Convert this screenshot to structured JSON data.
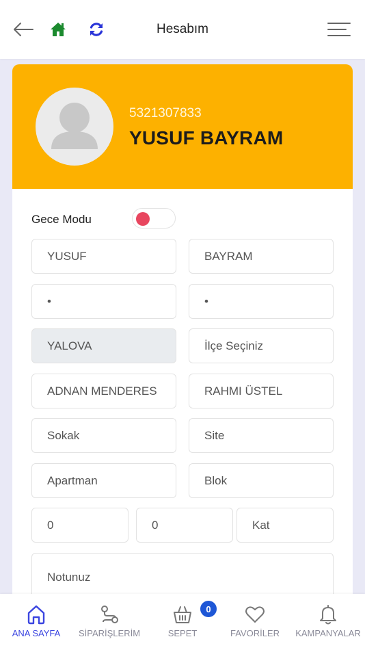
{
  "header": {
    "title": "Hesabım",
    "home_color": "#1b8a2e",
    "refresh_color": "#2a35d8"
  },
  "profile": {
    "phone": "5321307833",
    "name": "YUSUF BAYRAM",
    "banner_color": "#fdb100"
  },
  "settings": {
    "night_mode_label": "Gece Modu",
    "night_mode_on": false
  },
  "form": {
    "first_name": "YUSUF",
    "last_name": "BAYRAM",
    "field_left_dot": "•",
    "field_right_dot": "•",
    "city": "YALOVA",
    "district_placeholder": "İlçe Seçiniz",
    "neighborhood": "ADNAN MENDERES",
    "street_value": "RAHMI ÜSTEL",
    "sokak_placeholder": "Sokak",
    "site_placeholder": "Site",
    "apartman_placeholder": "Apartman",
    "blok_placeholder": "Blok",
    "number1": "0",
    "number2": "0",
    "kat_placeholder": "Kat",
    "note_placeholder": "Notunuz"
  },
  "bottom_nav": {
    "items": [
      {
        "label": "ANA SAYFA",
        "icon": "home-outline-icon",
        "active": true
      },
      {
        "label": "SİPARİŞLERİM",
        "icon": "route-icon",
        "active": false
      },
      {
        "label": "SEPET",
        "icon": "basket-icon",
        "active": false
      },
      {
        "label": "FAVORİLER",
        "icon": "heart-icon",
        "active": false
      },
      {
        "label": "KAMPANYALAR",
        "icon": "bell-icon",
        "active": false
      }
    ],
    "cart_count": "0",
    "active_color": "#3b45e0"
  }
}
